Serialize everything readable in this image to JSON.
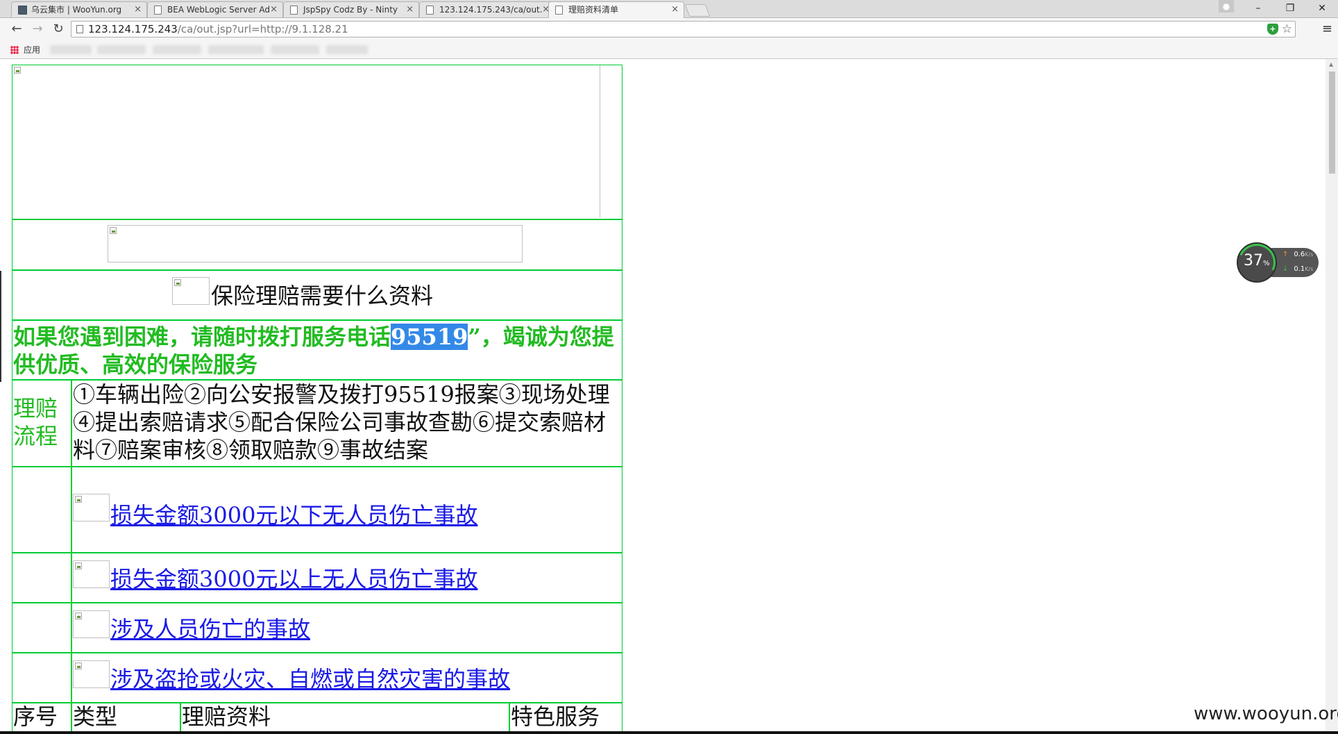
{
  "browser": {
    "tabs": [
      {
        "title": "乌云集市 | WooYun.org",
        "active": false
      },
      {
        "title": "BEA WebLogic Server Ad",
        "active": false
      },
      {
        "title": "JspSpy Codz By - Ninty",
        "active": false
      },
      {
        "title": "123.124.175.243/ca/out.",
        "active": false
      },
      {
        "title": "理赔资料清单",
        "active": true
      }
    ],
    "tab_close_glyph": "×",
    "window_buttons": {
      "minimize": "–",
      "restore": "❐",
      "close": "✕"
    },
    "nav": {
      "back": "←",
      "forward": "→",
      "reload": "↻",
      "menu": "≡"
    },
    "url_host": "123.124.175.243",
    "url_path": "/ca/out.jsp?url=http://9.1.128.21",
    "bookmarks_label": "应用",
    "star": "☆",
    "shield_label": "+"
  },
  "page": {
    "title_text": "保险理赔需要什么资料",
    "notice_before": "如果您遇到困难，请随时拨打服务电话",
    "notice_phone": "95519",
    "notice_after": "”，竭诚为您提供优质、高效的保险服务",
    "flow_label": "理赔流程",
    "flow_text": "①车辆出险②向公安报警及拨打95519报案③现场处理④提出索赔请求⑤配合保险公司事故查勘⑥提交索赔材料⑦赔案审核⑧领取赔款⑨事故结案",
    "links": [
      "损失金额3000元以下无人员伤亡事故",
      "损失金额3000元以上无人员伤亡事故",
      "涉及人员伤亡的事故",
      "涉及盗抢或火灾、自燃或自然灾害的事故"
    ],
    "table_headers": [
      "序号",
      "类型",
      "理赔资料",
      "特色服务"
    ]
  },
  "net_widget": {
    "percent": "37",
    "percent_sign": "%",
    "up": "0.6",
    "down": "0.1",
    "unit": "K/s",
    "up_arrow": "↑",
    "down_arrow": "↓"
  },
  "watermark": "www.wooyun.org",
  "colors": {
    "border_green": "#00cc33",
    "notice_green": "#22bb22",
    "link_blue": "#1a1ae6",
    "highlight": "#3389e8"
  }
}
